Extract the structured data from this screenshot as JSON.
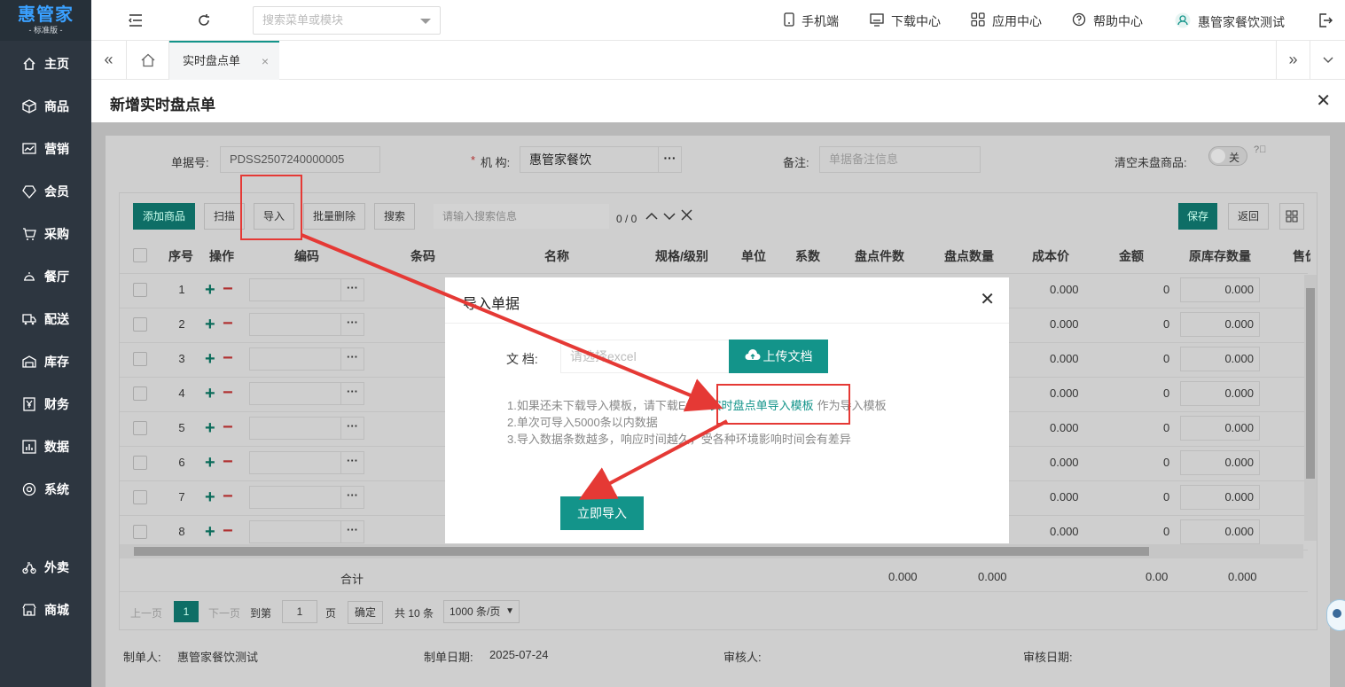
{
  "app": {
    "logo": "惠管家",
    "edition": "- 标准版 -"
  },
  "sidebar": {
    "items": [
      {
        "label": "主页",
        "icon": "home-icon"
      },
      {
        "label": "商品",
        "icon": "cube-icon"
      },
      {
        "label": "营销",
        "icon": "chart-icon"
      },
      {
        "label": "会员",
        "icon": "diamond-icon"
      },
      {
        "label": "采购",
        "icon": "cart-icon"
      },
      {
        "label": "餐厅",
        "icon": "bell-icon"
      },
      {
        "label": "配送",
        "icon": "truck-icon"
      },
      {
        "label": "库存",
        "icon": "warehouse-icon"
      },
      {
        "label": "财务",
        "icon": "yen-icon"
      },
      {
        "label": "数据",
        "icon": "bar-chart-icon"
      },
      {
        "label": "系统",
        "icon": "gear-icon"
      },
      {
        "label": "外卖",
        "icon": "bike-icon"
      },
      {
        "label": "商城",
        "icon": "shop-icon"
      }
    ]
  },
  "topbar": {
    "search_placeholder": "搜索菜单或模块",
    "mobile": "手机端",
    "download": "下载中心",
    "apps": "应用中心",
    "help": "帮助中心",
    "user": "惠管家餐饮测试"
  },
  "tabs": {
    "active": "实时盘点单"
  },
  "page": {
    "title": "新增实时盘点单"
  },
  "form": {
    "doc_no_label": "单据号:",
    "doc_no": "PDSS2507240000005",
    "org_label": "机 构:",
    "org_required": "*",
    "org": "惠管家餐饮",
    "remark_label": "备注:",
    "remark_placeholder": "单据备注信息",
    "clear_label": "清空未盘商品:",
    "toggle": "关"
  },
  "toolbar": {
    "add": "添加商品",
    "scan": "扫描",
    "import": "导入",
    "batch_delete": "批量删除",
    "search": "搜索",
    "search_placeholder": "请输入搜索信息",
    "counter": "0 / 0",
    "save": "保存",
    "back": "返回"
  },
  "table": {
    "headers": [
      "序号",
      "操作",
      "编码",
      "条码",
      "名称",
      "规格/级别",
      "单位",
      "系数",
      "盘点件数",
      "盘点数量",
      "成本价",
      "金额",
      "原库存数量",
      "售价"
    ],
    "rows": [
      {
        "no": "1",
        "cost": "0.000",
        "amount": "0",
        "stock": "0.000"
      },
      {
        "no": "2",
        "cost": "0.000",
        "amount": "0",
        "stock": "0.000"
      },
      {
        "no": "3",
        "cost": "0.000",
        "amount": "0",
        "stock": "0.000"
      },
      {
        "no": "4",
        "cost": "0.000",
        "amount": "0",
        "stock": "0.000"
      },
      {
        "no": "5",
        "cost": "0.000",
        "amount": "0",
        "stock": "0.000"
      },
      {
        "no": "6",
        "cost": "0.000",
        "amount": "0",
        "stock": "0.000"
      },
      {
        "no": "7",
        "cost": "0.000",
        "amount": "0",
        "stock": "0.000"
      },
      {
        "no": "8",
        "cost": "0.000",
        "amount": "0",
        "stock": "0.000"
      }
    ],
    "total_label": "合计",
    "total_count": "0.000",
    "total_qty": "0.000",
    "total_amount": "0.00",
    "total_stock": "0.000"
  },
  "pager": {
    "prev": "上一页",
    "page": "1",
    "next": "下一页",
    "goto": "到第",
    "goto_value": "1",
    "page_unit": "页",
    "confirm": "确定",
    "total": "共 10 条",
    "size": "1000 条/页"
  },
  "footer": {
    "maker_label": "制单人:",
    "maker": "惠管家餐饮测试",
    "date_label": "制单日期:",
    "date": "2025-07-24",
    "auditor_label": "审核人:",
    "audit_date_label": "审核日期:"
  },
  "modal": {
    "title": "导入单据",
    "file_label": "文 档:",
    "file_placeholder": "请选择excel",
    "upload": "上传文档",
    "tip1_pre": "1.如果还未下载导入模板，请下载Excel",
    "tip1_link": "实时盘点单导入模板",
    "tip1_post": "作为导入模板",
    "tip2": "2.单次可导入5000条以内数据",
    "tip3": "3.导入数据条数越多，响应时间越久，受各种环境影响时间会有差异",
    "import_now": "立即导入"
  },
  "colors": {
    "accent": "#13948a",
    "sidebar": "#2d3640",
    "annotation": "#e53935"
  }
}
